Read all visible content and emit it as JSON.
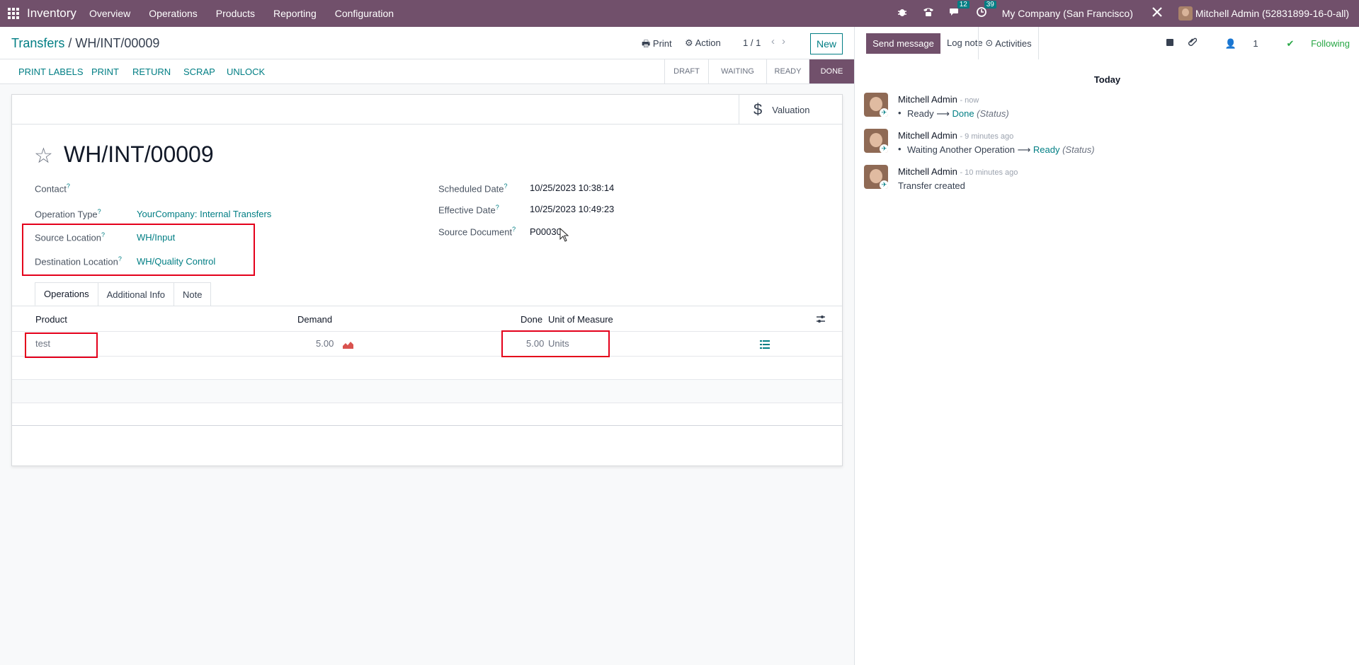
{
  "navbar": {
    "app_name": "Inventory",
    "menu": [
      "Overview",
      "Operations",
      "Products",
      "Reporting",
      "Configuration"
    ],
    "messages_count": "12",
    "activities_count": "39",
    "company": "My Company (San Francisco)",
    "user": "Mitchell Admin (52831899-16-0-all)",
    "accent_color": "#71506b"
  },
  "control_panel": {
    "breadcrumb_parent": "Transfers",
    "breadcrumb_sep": "/",
    "breadcrumb_current": "WH/INT/00009",
    "print_label": "Print",
    "action_label": "Action",
    "pager": "1 / 1",
    "new_label": "New"
  },
  "statusbar": {
    "buttons": [
      "PRINT LABELS",
      "PRINT",
      "RETURN",
      "SCRAP",
      "UNLOCK"
    ],
    "stages": [
      "DRAFT",
      "WAITING",
      "READY",
      "DONE"
    ],
    "current_stage": "DONE"
  },
  "form": {
    "valuation_label": "Valuation",
    "title": "WH/INT/00009",
    "fields_left": {
      "contact_label": "Contact",
      "contact_value": "",
      "operation_type_label": "Operation Type",
      "operation_type_value": "YourCompany: Internal Transfers",
      "source_location_label": "Source Location",
      "source_location_value": "WH/Input",
      "destination_location_label": "Destination Location",
      "destination_location_value": "WH/Quality Control"
    },
    "fields_right": {
      "scheduled_date_label": "Scheduled Date",
      "scheduled_date_value": "10/25/2023 10:38:14",
      "effective_date_label": "Effective Date",
      "effective_date_value": "10/25/2023 10:49:23",
      "source_document_label": "Source Document",
      "source_document_value": "P00030"
    },
    "tabs": [
      "Operations",
      "Additional Info",
      "Note"
    ],
    "table": {
      "headers": {
        "product": "Product",
        "demand": "Demand",
        "done": "Done",
        "uom": "Unit of Measure"
      },
      "rows": [
        {
          "product": "test",
          "demand": "5.00",
          "done": "5.00",
          "uom": "Units"
        }
      ]
    }
  },
  "chatter": {
    "send_message": "Send message",
    "log_note": "Log note",
    "activities": "Activities",
    "followers_count": "1",
    "following": "Following",
    "date_separator": "Today",
    "messages": [
      {
        "author": "Mitchell Admin",
        "when": "- now",
        "from": "Ready",
        "to": "Done",
        "field": "(Status)"
      },
      {
        "author": "Mitchell Admin",
        "when": "- 9 minutes ago",
        "from": "Waiting Another Operation",
        "to": "Ready",
        "field": "(Status)"
      },
      {
        "author": "Mitchell Admin",
        "when": "- 10 minutes ago",
        "body": "Transfer created"
      }
    ]
  }
}
